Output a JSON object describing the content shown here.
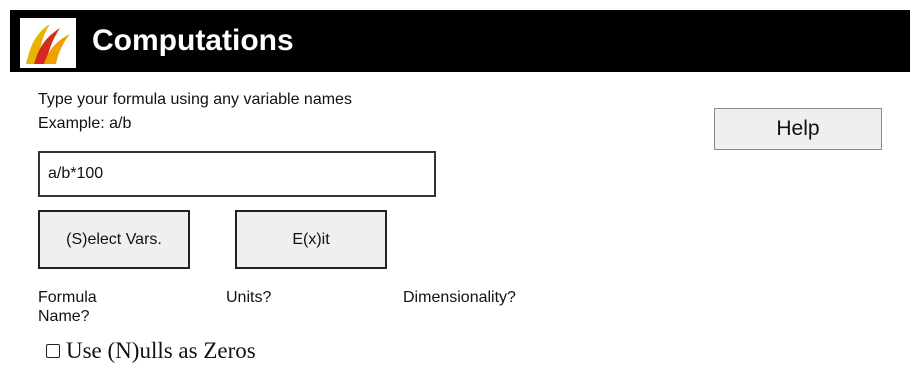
{
  "header": {
    "title": "Computations",
    "logo_icon": "flame-logo-icon",
    "background": "#000000"
  },
  "instructions": {
    "line1": "Type your formula using any variable names",
    "line2": "Example: a/b"
  },
  "formula": {
    "value": "a/b*100"
  },
  "buttons": {
    "help_label": "Help",
    "select_vars_label": "(S)elect Vars.",
    "exit_label": "E(x)it"
  },
  "fields": {
    "formula_name_line1": "Formula",
    "formula_name_line2": "Name?",
    "units_label": "Units?",
    "dimensionality_label": "Dimensionality?"
  },
  "options": {
    "nulls_as_zeros_label": "Use (N)ulls as Zeros",
    "nulls_as_zeros_checked": false
  }
}
